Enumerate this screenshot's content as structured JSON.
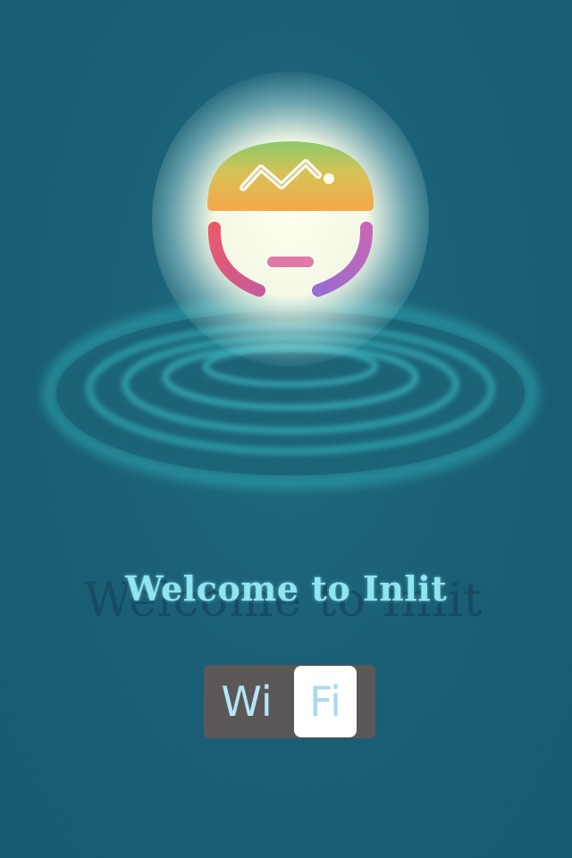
{
  "screen": {
    "background_color": "#1a5e74",
    "logo": {
      "icon_name": "rainbow-lightbulb-icon",
      "glow_color": "#fffff0",
      "colors": {
        "dome_top": "#8cc96a",
        "dome_bottom": "#f6a84a",
        "side_left": "#e45f79",
        "side_right": "#9a6bd0",
        "filament": "#e07aa8",
        "base_top": "#7a7fd9",
        "base_bottom": "#5ca8e8"
      }
    },
    "ripple_icon_name": "water-ripple-rings",
    "welcome_text": "Welcome to Inlit",
    "wifi_toggle": {
      "icon_name": "wifi-toggle",
      "left_label": "Wi",
      "right_label": "Fi",
      "state": "on"
    }
  }
}
